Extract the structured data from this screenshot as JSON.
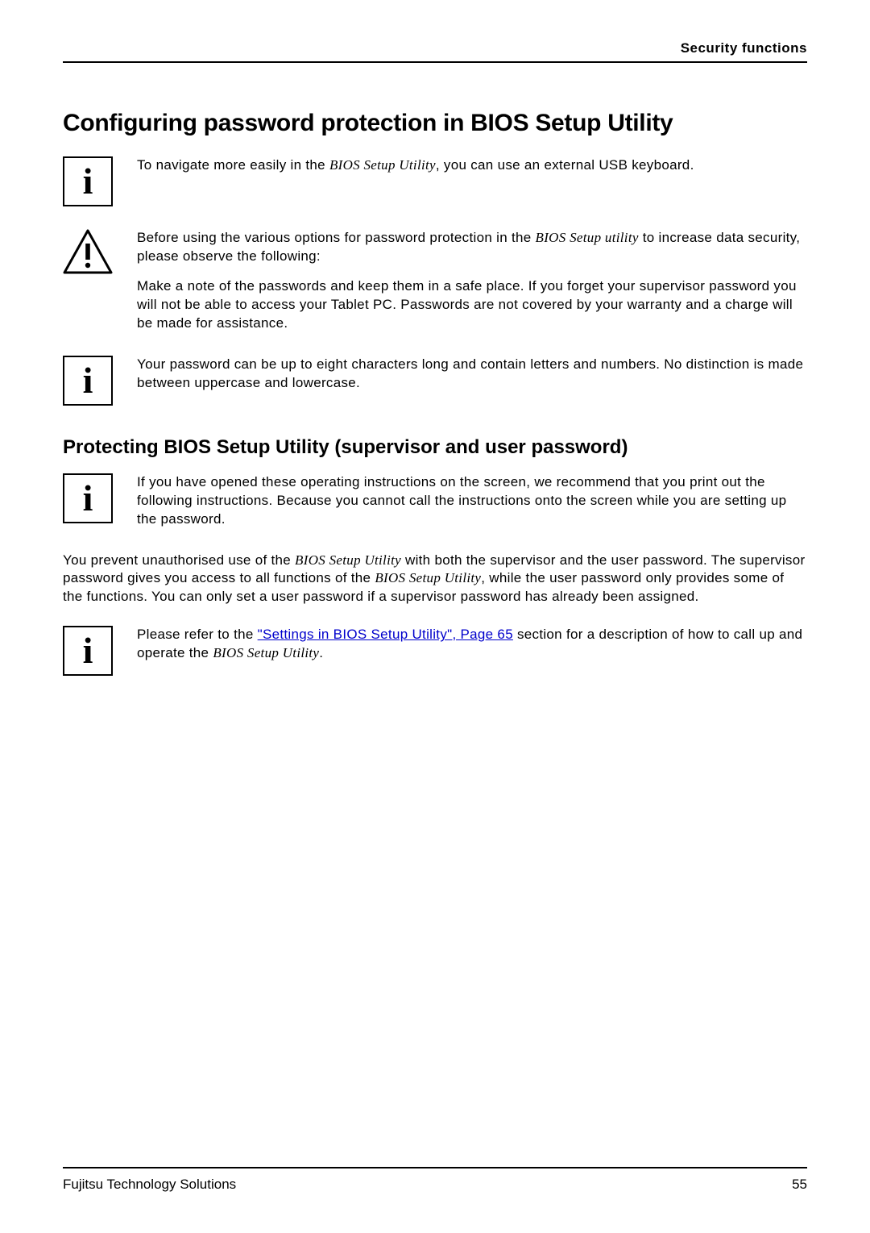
{
  "header": {
    "section_label": "Security functions"
  },
  "headings": {
    "main": "Configuring password protection in BIOS Setup Utility",
    "sub": "Protecting BIOS Setup Utility (supervisor and user password)"
  },
  "blocks": {
    "info1": {
      "text_pre": "To navigate more easily in the ",
      "italic": "BIOS Setup Utility",
      "text_post": ", you can use an external USB keyboard."
    },
    "warning": {
      "p1_pre": "Before using the various options for password protection in the ",
      "p1_italic": "BIOS Setup utility",
      "p1_post": " to increase data security, please observe the following:",
      "p2": "Make a note of the passwords and keep them in a safe place. If you forget your supervisor password you will not be able to access your Tablet PC. Passwords are not covered by your warranty and a charge will be made for assistance."
    },
    "info2": {
      "text": "Your password can be up to eight characters long and contain letters and numbers. No distinction is made between uppercase and lowercase."
    },
    "info3": {
      "text": "If you have opened these operating instructions on the screen, we recommend that you print out the following instructions. Because you cannot call the instructions onto the screen while you are setting up the password."
    },
    "paragraph": {
      "t1": "You prevent unauthorised use of the ",
      "i1": "BIOS Setup Utility",
      "t2": " with both the supervisor and the user password. The supervisor password gives you access to all functions of the ",
      "i2": "BIOS Setup Utility",
      "t3": ", while the user password only provides some of the functions. You can only set a user password if a supervisor password has already been assigned."
    },
    "info4": {
      "t1": "Please refer to the ",
      "link": "\"Settings in BIOS Setup Utility\", Page 65",
      "t2": " section for a description of how to call up and operate the ",
      "i1": "BIOS Setup Utility",
      "t3": "."
    }
  },
  "footer": {
    "company": "Fujitsu Technology Solutions",
    "page": "55"
  }
}
